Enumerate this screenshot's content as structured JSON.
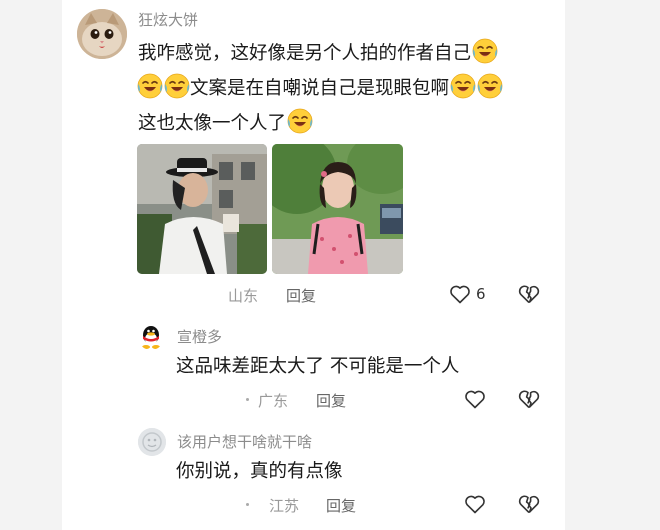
{
  "comment_main": {
    "username": "狂炫大饼",
    "line1": "我咋感觉，这好像是另个人拍的作者自己",
    "line2": "文案是在自嘲说自己是现眼包啊",
    "line3": "这也太像一个人了",
    "location": "山东",
    "reply_label": "回复",
    "like_count": "6",
    "emoji_name": "crying-laughing-emoji"
  },
  "replies": [
    {
      "username": "宣橙多",
      "text": "这品味差距太大了 不可能是一个人",
      "location": "广东",
      "reply_label": "回复"
    },
    {
      "username": "该用户想干啥就干啥",
      "text": "你别说，真的有点像",
      "location": "江苏",
      "reply_label": "回复"
    }
  ],
  "icons": {
    "like": "heart-outline-icon",
    "dislike": "broken-heart-icon"
  },
  "colors": {
    "background": "#f3f3f3",
    "card": "#ffffff",
    "username": "#8c8c8c",
    "text": "#1a1a1a"
  }
}
